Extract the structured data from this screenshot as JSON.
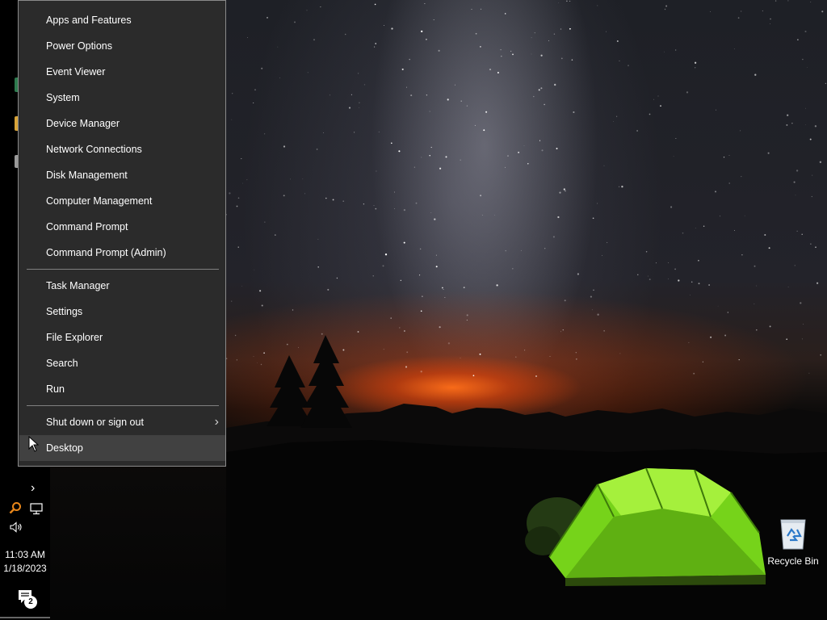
{
  "menu": {
    "group1": [
      "Apps and Features",
      "Power Options",
      "Event Viewer",
      "System",
      "Device Manager",
      "Network Connections",
      "Disk Management",
      "Computer Management",
      "Command Prompt",
      "Command Prompt (Admin)"
    ],
    "group2": [
      "Task Manager",
      "Settings",
      "File Explorer",
      "Search",
      "Run"
    ],
    "shutdown": "Shut down or sign out",
    "desktop": "Desktop",
    "highlighted_item": "Desktop"
  },
  "taskbar": {
    "time": "11:03 AM",
    "date": "1/18/2023",
    "notification_count": "2",
    "tray_icons": [
      "chevron-right-icon",
      "search-icon",
      "network-icon",
      "volume-icon",
      "action-center-icon"
    ]
  },
  "desktop": {
    "recycle_bin_label": "Recycle Bin"
  },
  "colors": {
    "menu_bg": "#2b2b2b",
    "menu_hover": "#414141",
    "menu_border": "#8a8a8a",
    "taskbar_bg": "#000000",
    "tent_green": "#7fe21f"
  }
}
